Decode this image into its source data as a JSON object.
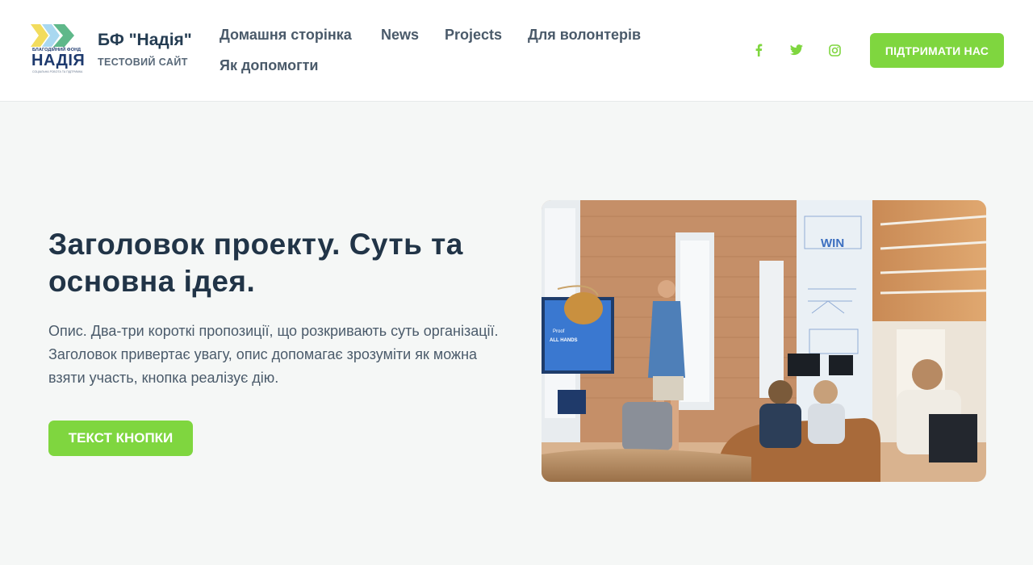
{
  "header": {
    "logo": {
      "small_text": "БЛАГОДІЙНИЙ ФОНД",
      "big_text": "НАДІЯ",
      "tiny_text": "СОЦІАЛЬНА РОБОТА ТА ПІДТРИМКА"
    },
    "brand_name": "БФ \"Надія\"",
    "brand_subtitle": "ТЕСТОВИЙ САЙТ",
    "nav": [
      {
        "label": "Домашня сторінка"
      },
      {
        "label": "News"
      },
      {
        "label": "Projects"
      },
      {
        "label": "Для волонтерів"
      },
      {
        "label": "Як допомогти"
      }
    ],
    "social": [
      {
        "icon": "facebook-icon"
      },
      {
        "icon": "twitter-icon"
      },
      {
        "icon": "instagram-icon"
      }
    ],
    "support_button": "ПІДТРИМАТИ НАС"
  },
  "hero": {
    "title": "Заголовок проекту. Суть та основна ідея.",
    "description": "Опис. Два-три короткі пропозиції, що розкривають суть організації. Заголовок привертає увагу, опис допомагає зрозуміти як можна взяти участь, кнопка реалізує дію.",
    "button": "ТЕКСТ КНОПКИ",
    "image": {
      "screen_text_1": "Proof",
      "screen_text_2": "ALL HANDS",
      "wall_text": "WIN"
    }
  },
  "colors": {
    "accent": "#7fd63f",
    "heading": "#213447",
    "page_background": "#f5f7f6"
  }
}
